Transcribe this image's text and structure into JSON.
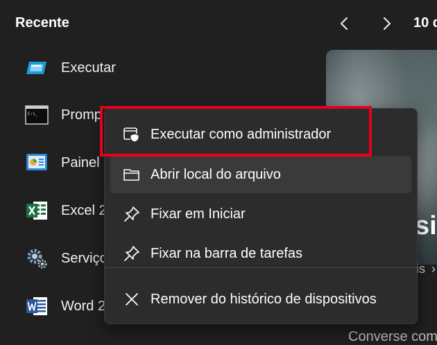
{
  "header": {
    "title": "Recente",
    "date_partial": "10 d",
    "prev_icon": "chevron-left-icon",
    "next_icon": "chevron-right-icon"
  },
  "recent_apps": [
    {
      "label": "Executar",
      "icon": "run-icon"
    },
    {
      "label": "Promp",
      "icon": "command-prompt-icon"
    },
    {
      "label": "Painel",
      "icon": "control-panel-icon"
    },
    {
      "label": "Excel 2",
      "icon": "excel-icon"
    },
    {
      "label": "Serviço",
      "icon": "services-gear-icon"
    },
    {
      "label": "Word 2",
      "icon": "word-icon"
    }
  ],
  "news": {
    "headline_partial": "si",
    "subtitle_partial": "is",
    "bottom_text": "Converse com"
  },
  "context_menu": {
    "items": [
      {
        "label": "Executar como administrador",
        "icon": "shield-window-icon"
      },
      {
        "label": "Abrir local do arquivo",
        "icon": "folder-icon"
      },
      {
        "label": "Fixar em Iniciar",
        "icon": "pin-icon"
      },
      {
        "label": "Fixar na barra de tarefas",
        "icon": "pin-icon"
      },
      {
        "label": "Remover do histórico de dispositivos",
        "icon": "close-icon"
      }
    ]
  },
  "colors": {
    "background": "#202020",
    "menu_background": "#2c2c2c",
    "highlight_border": "#e8001c"
  }
}
